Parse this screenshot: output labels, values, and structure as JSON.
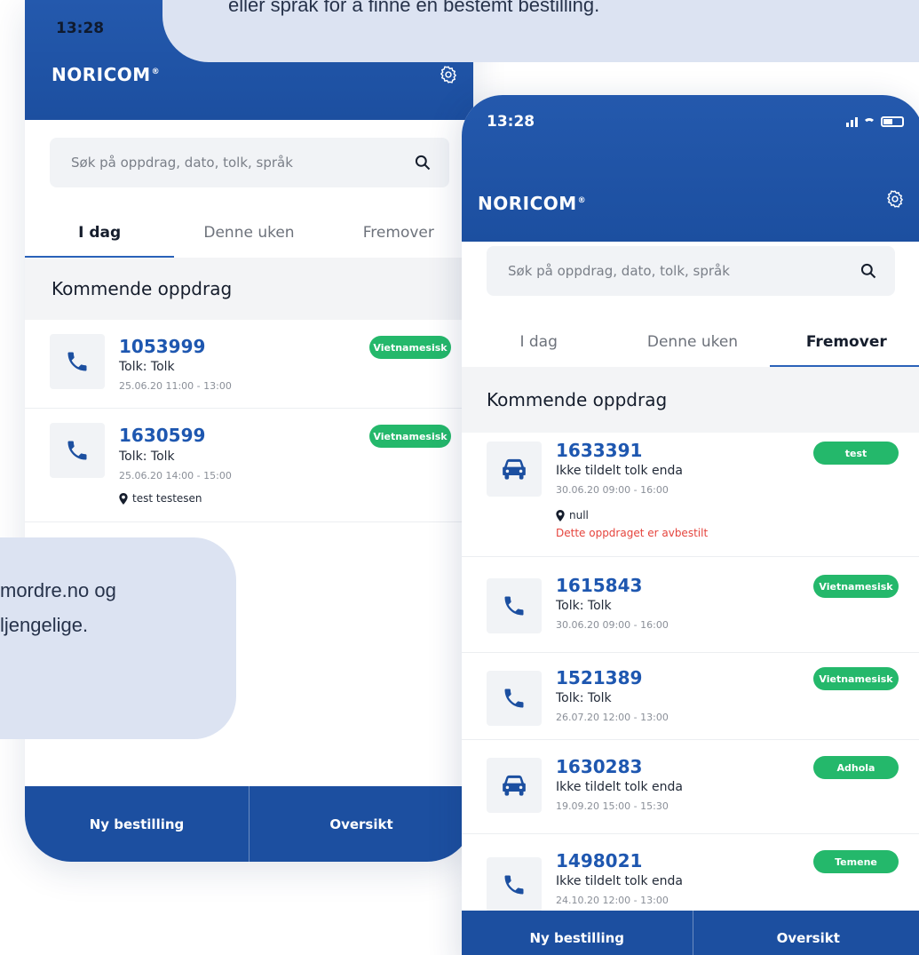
{
  "callouts": {
    "top_text": "eller språk for å finne en bestemt bestilling.",
    "bottom_line1": "mordre.no og",
    "bottom_line2": "ljengelige."
  },
  "colors": {
    "header_blue": "#1c4fa0",
    "link_blue": "#1e57b0",
    "badge_green": "#24b86b",
    "warning_red": "#e5443d",
    "callout_bg": "#dce3f2"
  },
  "phone_left": {
    "status_time": "13:28",
    "logo": "NORICOM",
    "logo_mark": "®",
    "search_placeholder": "Søk på oppdrag, dato, tolk, språk",
    "tabs": [
      {
        "label": "I dag",
        "active": true
      },
      {
        "label": "Denne uken",
        "active": false
      },
      {
        "label": "Fremover",
        "active": false
      }
    ],
    "section_title": "Kommende oppdrag",
    "items": [
      {
        "id": "1053999",
        "icon": "phone-icon",
        "sub": "Tolk: Tolk",
        "time": "25.06.20 11:00 - 13:00",
        "badge": "Vietnamesisk",
        "location": "",
        "warning": ""
      },
      {
        "id": "1630599",
        "icon": "phone-icon",
        "sub": "Tolk: Tolk",
        "time": "25.06.20 14:00 - 15:00",
        "badge": "Vietnamesisk",
        "location": "test testesen",
        "warning": ""
      }
    ],
    "bottom": {
      "left": "Ny bestilling",
      "right": "Oversikt"
    }
  },
  "phone_right": {
    "status_time": "13:28",
    "logo": "NORICOM",
    "logo_mark": "®",
    "search_placeholder": "Søk på oppdrag, dato, tolk, språk",
    "tabs": [
      {
        "label": "I dag",
        "active": false
      },
      {
        "label": "Denne uken",
        "active": false
      },
      {
        "label": "Fremover",
        "active": true
      }
    ],
    "section_title": "Kommende oppdrag",
    "items": [
      {
        "id": "1633391",
        "icon": "car-icon",
        "sub": "Ikke tildelt tolk enda",
        "time": "30.06.20 09:00 - 16:00",
        "badge": "test",
        "location": "null",
        "warning": "Dette oppdraget er avbestilt"
      },
      {
        "id": "1615843",
        "icon": "phone-icon",
        "sub": "Tolk: Tolk",
        "time": "30.06.20 09:00 - 16:00",
        "badge": "Vietnamesisk",
        "location": "",
        "warning": ""
      },
      {
        "id": "1521389",
        "icon": "phone-icon",
        "sub": "Tolk: Tolk",
        "time": "26.07.20 12:00 - 13:00",
        "badge": "Vietnamesisk",
        "location": "",
        "warning": ""
      },
      {
        "id": "1630283",
        "icon": "car-icon",
        "sub": "Ikke tildelt tolk enda",
        "time": "19.09.20 15:00 - 15:30",
        "badge": "Adhola",
        "location": "",
        "warning": ""
      },
      {
        "id": "1498021",
        "icon": "phone-icon",
        "sub": "Ikke tildelt tolk enda",
        "time": "24.10.20 12:00 - 13:00",
        "badge": "Temene",
        "location": "",
        "warning": ""
      }
    ],
    "bottom": {
      "left": "Ny bestilling",
      "right": "Oversikt"
    }
  }
}
